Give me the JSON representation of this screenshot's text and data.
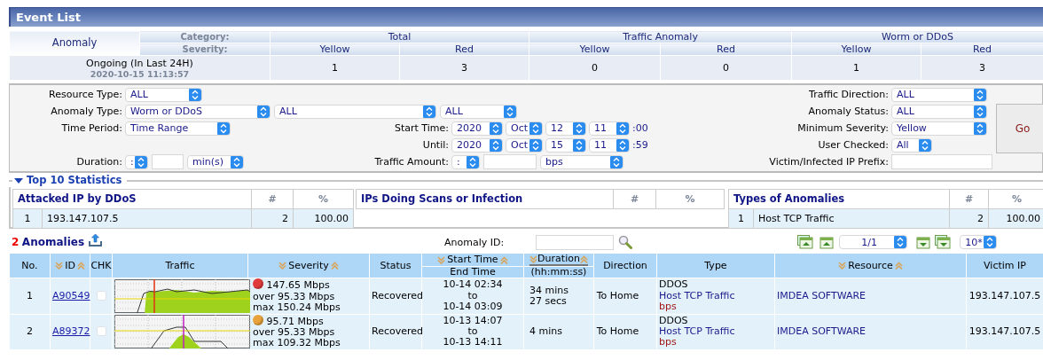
{
  "panel_title": "Event List",
  "summary": {
    "corner": "Anomaly",
    "category_label": "Category:",
    "severity_label": "Severity:",
    "row_label": "Ongoing (In Last 24H)",
    "timestamp": "2020-10-15 11:13:57",
    "categories": [
      {
        "name": "Total",
        "severities": [
          {
            "name": "Yellow",
            "count": "1"
          },
          {
            "name": "Red",
            "count": "3"
          }
        ]
      },
      {
        "name": "Traffic Anomaly",
        "severities": [
          {
            "name": "Yellow",
            "count": "0"
          },
          {
            "name": "Red",
            "count": "0"
          }
        ]
      },
      {
        "name": "Worm or DDoS",
        "severities": [
          {
            "name": "Yellow",
            "count": "1"
          },
          {
            "name": "Red",
            "count": "3"
          }
        ]
      }
    ]
  },
  "filters": {
    "resource_type": {
      "label": "Resource Type:",
      "value": "ALL"
    },
    "anomaly_type": {
      "label": "Anomaly Type:",
      "values": [
        "Worm or DDoS",
        "ALL",
        "ALL"
      ]
    },
    "time_period": {
      "label": "Time Period:",
      "value": "Time Range"
    },
    "start_time": {
      "label": "Start Time:",
      "year": "2020",
      "month": "Oct",
      "day": "12",
      "hour": "11",
      "suffix": ":00"
    },
    "until": {
      "label": "Until:",
      "year": "2020",
      "month": "Oct",
      "day": "15",
      "hour": "11",
      "suffix": ":59"
    },
    "duration": {
      "label": "Duration:",
      "operator": ":",
      "unit": "min(s)"
    },
    "traffic_amount": {
      "label": "Traffic Amount:",
      "operator": ":",
      "unit": "bps"
    },
    "traffic_direction": {
      "label": "Traffic Direction:",
      "value": "ALL"
    },
    "anomaly_status": {
      "label": "Anomaly Status:",
      "value": "ALL"
    },
    "minimum_severity": {
      "label": "Minimum Severity:",
      "value": "Yellow"
    },
    "user_checked": {
      "label": "User Checked:",
      "value": "All"
    },
    "victim_prefix": {
      "label": "Victim/Infected IP Prefix:"
    },
    "go_button": "Go"
  },
  "top10": {
    "title": "Top 10 Statistics",
    "expanded": true,
    "tables": [
      {
        "title": "Attacked IP by DDoS",
        "count_header": "#",
        "percent_header": "%",
        "rows": [
          {
            "rank": "1",
            "name": "193.147.107.5",
            "count": "2",
            "percent": "100.00"
          }
        ]
      },
      {
        "title": "IPs Doing Scans or Infection",
        "count_header": "#",
        "percent_header": "%"
      },
      {
        "title": "Types of Anomalies",
        "count_header": "#",
        "percent_header": "%",
        "rows": [
          {
            "rank": "1",
            "name": "Host TCP Traffic",
            "count": "2",
            "percent": "100.00"
          }
        ]
      }
    ]
  },
  "anomalies": {
    "count": "2",
    "label": "Anomalies",
    "search_label": "Anomaly ID:",
    "page": "1/1",
    "page_size": "10*",
    "columns": [
      {
        "label": "No."
      },
      {
        "label": "ID",
        "sortable": true
      },
      {
        "label": "CHK"
      },
      {
        "label": "Traffic"
      },
      {
        "label": "Severity",
        "sortable": true
      },
      {
        "label": "Status"
      },
      {
        "label": "Start Time",
        "sub": "End Time",
        "sortable": true
      },
      {
        "label": "Duration",
        "sub": "(hh:mm:ss)",
        "sortable": true
      },
      {
        "label": "Direction"
      },
      {
        "label": "Type"
      },
      {
        "label": "Resource",
        "sortable": true
      },
      {
        "label": "Victim IP"
      }
    ],
    "rows": [
      {
        "no": "1",
        "id": "A90549",
        "checked": false,
        "color": "#e03a3a",
        "rate": "147.65 Mbps",
        "threshold": "over 95.33 Mbps",
        "max": "max 150.24 Mbps",
        "status": "Recovered",
        "start": "10-14 02:34",
        "to": "to",
        "end": "10-14 03:09",
        "duration": [
          "34 mins",
          "27 secs"
        ],
        "direction": "To Home",
        "type": "DDOS",
        "subtype": "Host TCP Traffic",
        "unit": "bps",
        "resource": "IMDEA SOFTWARE",
        "victim_ip": "193.147.107.5"
      },
      {
        "no": "2",
        "id": "A89372",
        "checked": false,
        "color": "#e8a23c",
        "rate": "95.71 Mbps",
        "threshold": "over 95.33 Mbps",
        "max": "max 109.32 Mbps",
        "status": "Recovered",
        "start": "10-13 14:07",
        "to": "to",
        "end": "10-13 14:11",
        "duration": [
          "4 mins"
        ],
        "direction": "To Home",
        "type": "DDOS",
        "subtype": "Host TCP Traffic",
        "unit": "bps",
        "resource": "IMDEA SOFTWARE",
        "victim_ip": "193.147.107.5"
      }
    ]
  }
}
